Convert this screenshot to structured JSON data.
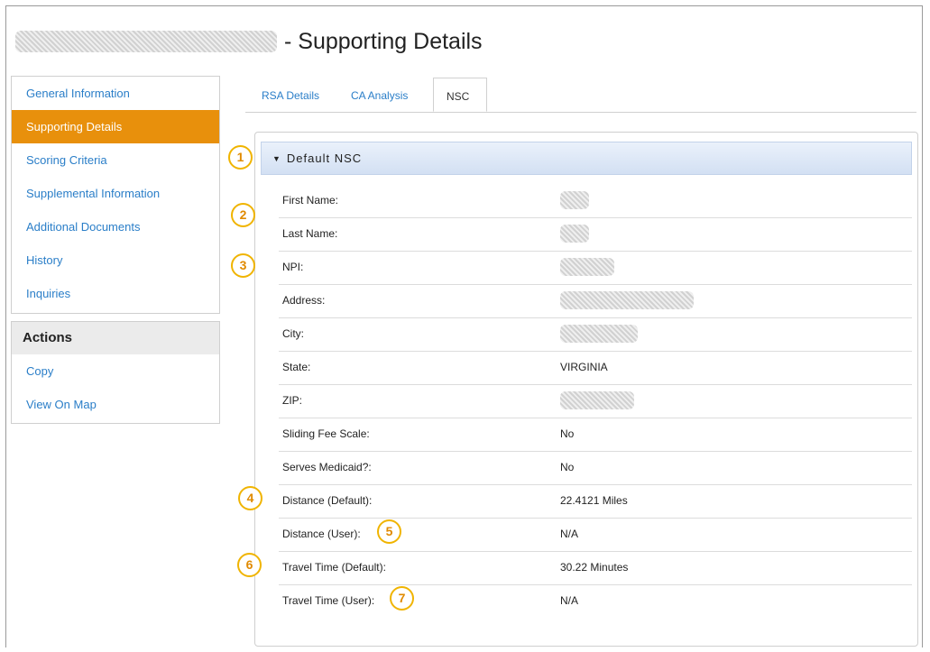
{
  "page": {
    "title": "- Supporting Details"
  },
  "sidebar": {
    "items": [
      {
        "label": "General Information"
      },
      {
        "label": "Supporting Details"
      },
      {
        "label": "Scoring Criteria"
      },
      {
        "label": "Supplemental Information"
      },
      {
        "label": "Additional Documents"
      },
      {
        "label": "History"
      },
      {
        "label": "Inquiries"
      }
    ]
  },
  "actions": {
    "heading": "Actions",
    "items": [
      {
        "label": "Copy"
      },
      {
        "label": "View On Map"
      }
    ]
  },
  "tabs": [
    {
      "label": "RSA Details"
    },
    {
      "label": "CA Analysis"
    },
    {
      "label": "NSC"
    }
  ],
  "panel": {
    "heading": "Default NSC"
  },
  "fields": [
    {
      "label": "First Name:",
      "value": ""
    },
    {
      "label": "Last Name:",
      "value": ""
    },
    {
      "label": "NPI:",
      "value": ""
    },
    {
      "label": "Address:",
      "value": ""
    },
    {
      "label": "City:",
      "value": ""
    },
    {
      "label": "State:",
      "value": "VIRGINIA"
    },
    {
      "label": "ZIP:",
      "value": ""
    },
    {
      "label": "Sliding Fee Scale:",
      "value": "No"
    },
    {
      "label": "Serves Medicaid?:",
      "value": "No"
    },
    {
      "label": "Distance (Default):",
      "value": "22.4121 Miles"
    },
    {
      "label": "Distance (User):",
      "value": "N/A"
    },
    {
      "label": "Travel Time (Default):",
      "value": "30.22 Minutes"
    },
    {
      "label": "Travel Time (User):",
      "value": "N/A"
    }
  ],
  "callouts": [
    "1",
    "2",
    "3",
    "4",
    "5",
    "6",
    "7"
  ],
  "colors": {
    "accent": "#e8900c",
    "link": "#2a7ec8",
    "callout": "#f0b400"
  }
}
